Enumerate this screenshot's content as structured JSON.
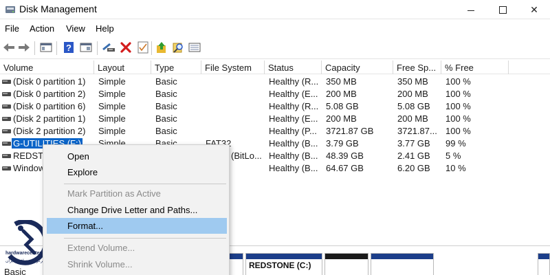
{
  "window": {
    "title": "Disk Management",
    "controls": {
      "minimize": "min-icon",
      "maximize": "max-icon",
      "close": "✕"
    }
  },
  "menubar": {
    "items": [
      "File",
      "Action",
      "View",
      "Help"
    ]
  },
  "toolbar": {
    "icons": [
      "back-arrow-icon",
      "forward-arrow-icon",
      "console-tree-icon",
      "help-icon",
      "properties-pane-icon",
      "connect-drive-icon",
      "delete-icon",
      "properties-check-icon",
      "new-folder-up-icon",
      "search-magnifier-icon",
      "list-view-icon"
    ],
    "colors": {
      "delete": "#d31c1c",
      "help": "#2b57c6",
      "folder": "#e8b931"
    }
  },
  "table": {
    "columns": [
      "Volume",
      "Layout",
      "Type",
      "File System",
      "Status",
      "Capacity",
      "Free Sp...",
      "% Free"
    ],
    "rows": [
      {
        "volume": "(Disk 0 partition 1)",
        "layout": "Simple",
        "type": "Basic",
        "fs": "",
        "status": "Healthy (R...",
        "capacity": "350 MB",
        "free": "350 MB",
        "pct": "100 %"
      },
      {
        "volume": "(Disk 0 partition 2)",
        "layout": "Simple",
        "type": "Basic",
        "fs": "",
        "status": "Healthy (E...",
        "capacity": "200 MB",
        "free": "200 MB",
        "pct": "100 %"
      },
      {
        "volume": "(Disk 0 partition 6)",
        "layout": "Simple",
        "type": "Basic",
        "fs": "",
        "status": "Healthy (R...",
        "capacity": "5.08 GB",
        "free": "5.08 GB",
        "pct": "100 %"
      },
      {
        "volume": "(Disk 2 partition 1)",
        "layout": "Simple",
        "type": "Basic",
        "fs": "",
        "status": "Healthy (E...",
        "capacity": "200 MB",
        "free": "200 MB",
        "pct": "100 %"
      },
      {
        "volume": "(Disk 2 partition 2)",
        "layout": "Simple",
        "type": "Basic",
        "fs": "",
        "status": "Healthy (P...",
        "capacity": "3721.87 GB",
        "free": "3721.87...",
        "pct": "100 %"
      },
      {
        "volume": "G-UTILITIES (F:)",
        "layout": "Simple",
        "type": "Basic",
        "fs": "FAT32",
        "status": "Healthy (B...",
        "capacity": "3.79 GB",
        "free": "3.77 GB",
        "pct": "99 %"
      },
      {
        "volume": "REDSTO",
        "layout": "",
        "type": "",
        "fs": "(BitLo...",
        "status": "Healthy (B...",
        "capacity": "48.39 GB",
        "free": "2.41 GB",
        "pct": "5 %"
      },
      {
        "volume": "Window",
        "layout": "",
        "type": "",
        "fs": "",
        "status": "Healthy (B...",
        "capacity": "64.67 GB",
        "free": "6.20 GB",
        "pct": "10 %"
      }
    ]
  },
  "context_menu": {
    "items": [
      {
        "label": "Open",
        "disabled": false
      },
      {
        "label": "Explore",
        "disabled": false
      },
      {
        "label": "Mark Partition as Active",
        "disabled": true
      },
      {
        "label": "Change Drive Letter and Paths...",
        "disabled": false
      },
      {
        "label": "Format...",
        "disabled": false,
        "highlighted": true
      },
      {
        "label": "Extend Volume...",
        "disabled": true
      },
      {
        "label": "Shrink Volume...",
        "disabled": true
      }
    ]
  },
  "disk_panel": {
    "disk_label": "Basic",
    "partition_label": "REDSTONE (C:)"
  },
  "watermark": {
    "site": "hardwarecenter.ir",
    "tagline": "مرکز سخت افزار ایران"
  },
  "colors": {
    "selection": "#0a64c8",
    "menu_highlight": "#9fcaf0",
    "partition_bar": "#1c3e8a",
    "logo": "#1a2a5a"
  }
}
